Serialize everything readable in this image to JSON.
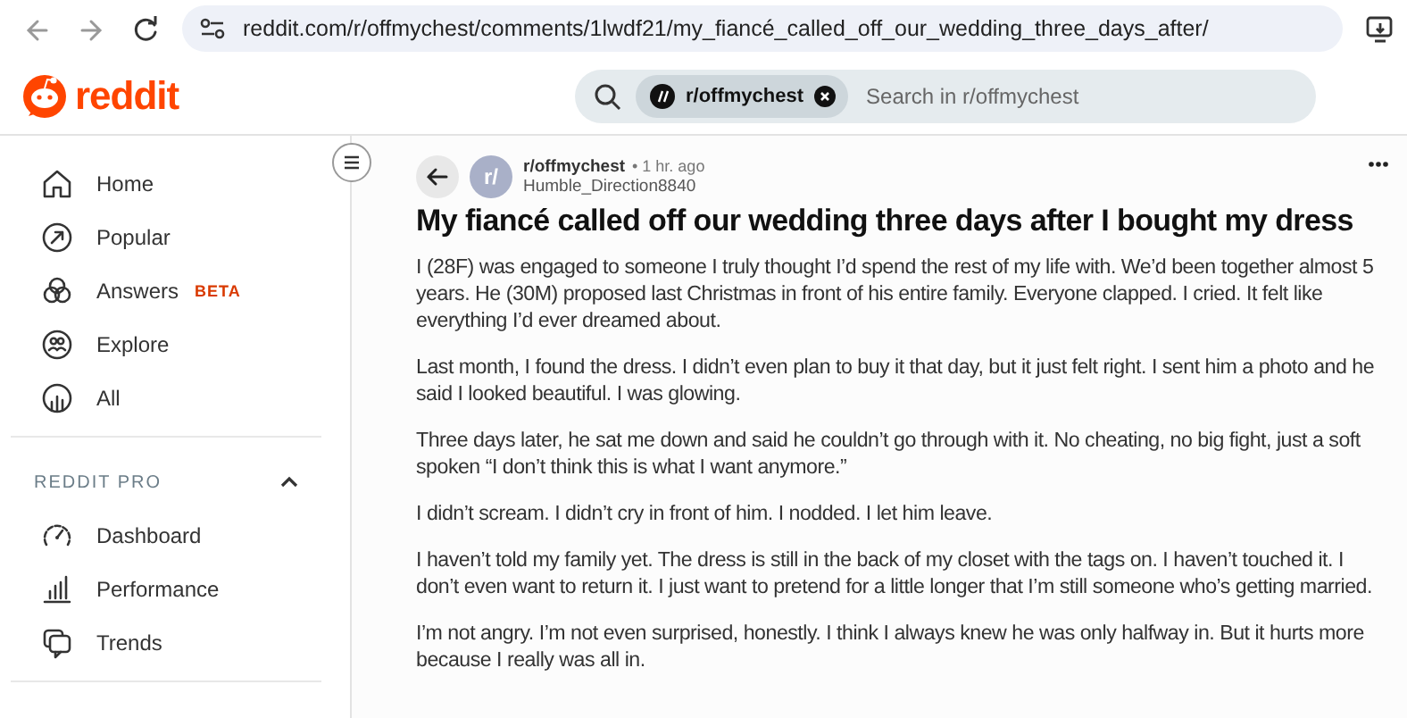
{
  "browser": {
    "url": "reddit.com/r/offmychest/comments/1lwdf21/my_fiancé_called_off_our_wedding_three_days_after/"
  },
  "header": {
    "logo": "reddit",
    "search": {
      "chip": "r/offmychest",
      "placeholder": "Search in r/offmychest"
    }
  },
  "sidebar": {
    "items": [
      {
        "label": "Home"
      },
      {
        "label": "Popular"
      },
      {
        "label": "Answers",
        "badge": "BETA"
      },
      {
        "label": "Explore"
      },
      {
        "label": "All"
      }
    ],
    "sections": [
      {
        "title": "REDDIT PRO",
        "expanded": true,
        "items": [
          {
            "label": "Dashboard"
          },
          {
            "label": "Performance"
          },
          {
            "label": "Trends"
          }
        ]
      }
    ]
  },
  "post": {
    "avatar": "r/",
    "community": "r/offmychest",
    "time": "• 1 hr. ago",
    "author": "Humble_Direction8840",
    "title": "My fiancé called off our wedding three days after I bought my dress",
    "paragraphs": [
      "I (28F) was engaged to someone I truly thought I’d spend the rest of my life with. We’d been together almost 5 years. He (30M) proposed last Christmas in front of his entire family. Everyone clapped. I cried. It felt like everything I’d ever dreamed about.",
      "Last month, I found the dress. I didn’t even plan to buy it that day, but it just felt right. I sent him a photo and he said I looked beautiful. I was glowing.",
      "Three days later, he sat me down and said he couldn’t go through with it. No cheating, no big fight, just a soft spoken “I don’t think this is what I want anymore.”",
      "I didn’t scream. I didn’t cry in front of him. I nodded. I let him leave.",
      "I haven’t told my family yet. The dress is still in the back of my closet with the tags on. I haven’t touched it. I don’t even want to return it. I just want to pretend for a little longer that I’m still someone who’s getting married.",
      "I’m not angry. I’m not even surprised, honestly. I think I always knew he was only halfway in. But it hurts more because I really was all in."
    ]
  }
}
